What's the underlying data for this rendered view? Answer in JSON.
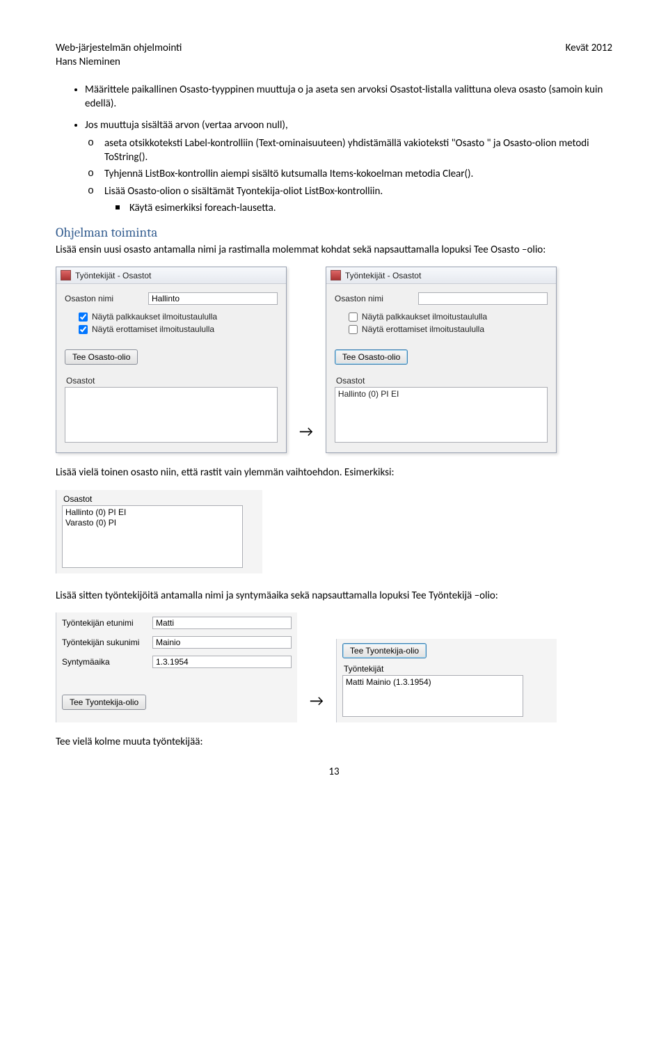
{
  "header": {
    "course": "Web-järjestelmän ohjelmointi",
    "author": "Hans Nieminen",
    "term": "Kevät 2012"
  },
  "bullets": {
    "b1": "Määrittele paikallinen Osasto-tyyppinen muuttuja o ja aseta sen arvoksi Osastot-listalla valittuna oleva osasto (samoin kuin edellä).",
    "b2": "Jos muuttuja sisältää arvon (vertaa arvoon null),",
    "b2a": "aseta otsikkoteksti Label-kontrolliin (Text-ominaisuuteen) yhdistämällä vakioteksti \"Osasto \" ja Osasto-olion metodi ToString().",
    "b2b": "Tyhjennä ListBox-kontrollin aiempi sisältö kutsumalla Items-kokoelman metodia Clear().",
    "b2c": "Lisää Osasto-olion o sisältämät Tyontekija-oliot ListBox-kontrolliin.",
    "b2c1": "Käytä esimerkiksi foreach-lausetta."
  },
  "sections": {
    "toiminta_heading": "Ohjelman toiminta",
    "toiminta_text": "Lisää ensin uusi osasto antamalla nimi ja rastimalla molemmat kohdat sekä napsauttamalla lopuksi Tee Osasto –olio:",
    "toinen_text": "Lisää vielä toinen osasto niin, että rastit vain ylemmän vaihtoehdon. Esimerkiksi:",
    "tyontekija_text": "Lisää sitten työntekijöitä antamalla nimi ja syntymäaika sekä napsauttamalla lopuksi Tee Työntekijä –olio:",
    "lopuksi_text": "Tee vielä kolme muuta työntekijää:"
  },
  "forms": {
    "title": "Työntekijät - Osastot",
    "osasto_nimi_lbl": "Osaston nimi",
    "osasto_nimi_val_hallinto": "Hallinto",
    "cb_palkkaus": "Näytä palkkaukset ilmoitustaululla",
    "cb_erottamiset": "Näytä erottamiset ilmoitustaululla",
    "btn_tee_osasto": "Tee Osasto-olio",
    "grp_osastot": "Osastot",
    "list_item_1": "Hallinto (0) PI EI",
    "list_item_2": "Varasto (0) PI",
    "etunimi_lbl": "Työntekijän etunimi",
    "sukunimi_lbl": "Työntekijän sukunimi",
    "syntyma_lbl": "Syntymäaika",
    "etunimi_val": "Matti",
    "sukunimi_val": "Mainio",
    "syntyma_val": "1.3.1954",
    "btn_tee_tyontekija": "Tee Tyontekija-olio",
    "grp_tyontekijat": "Työntekijät",
    "tyontekija_item": "Matti Mainio (1.3.1954)"
  },
  "arrow": "→",
  "pagenum": "13"
}
